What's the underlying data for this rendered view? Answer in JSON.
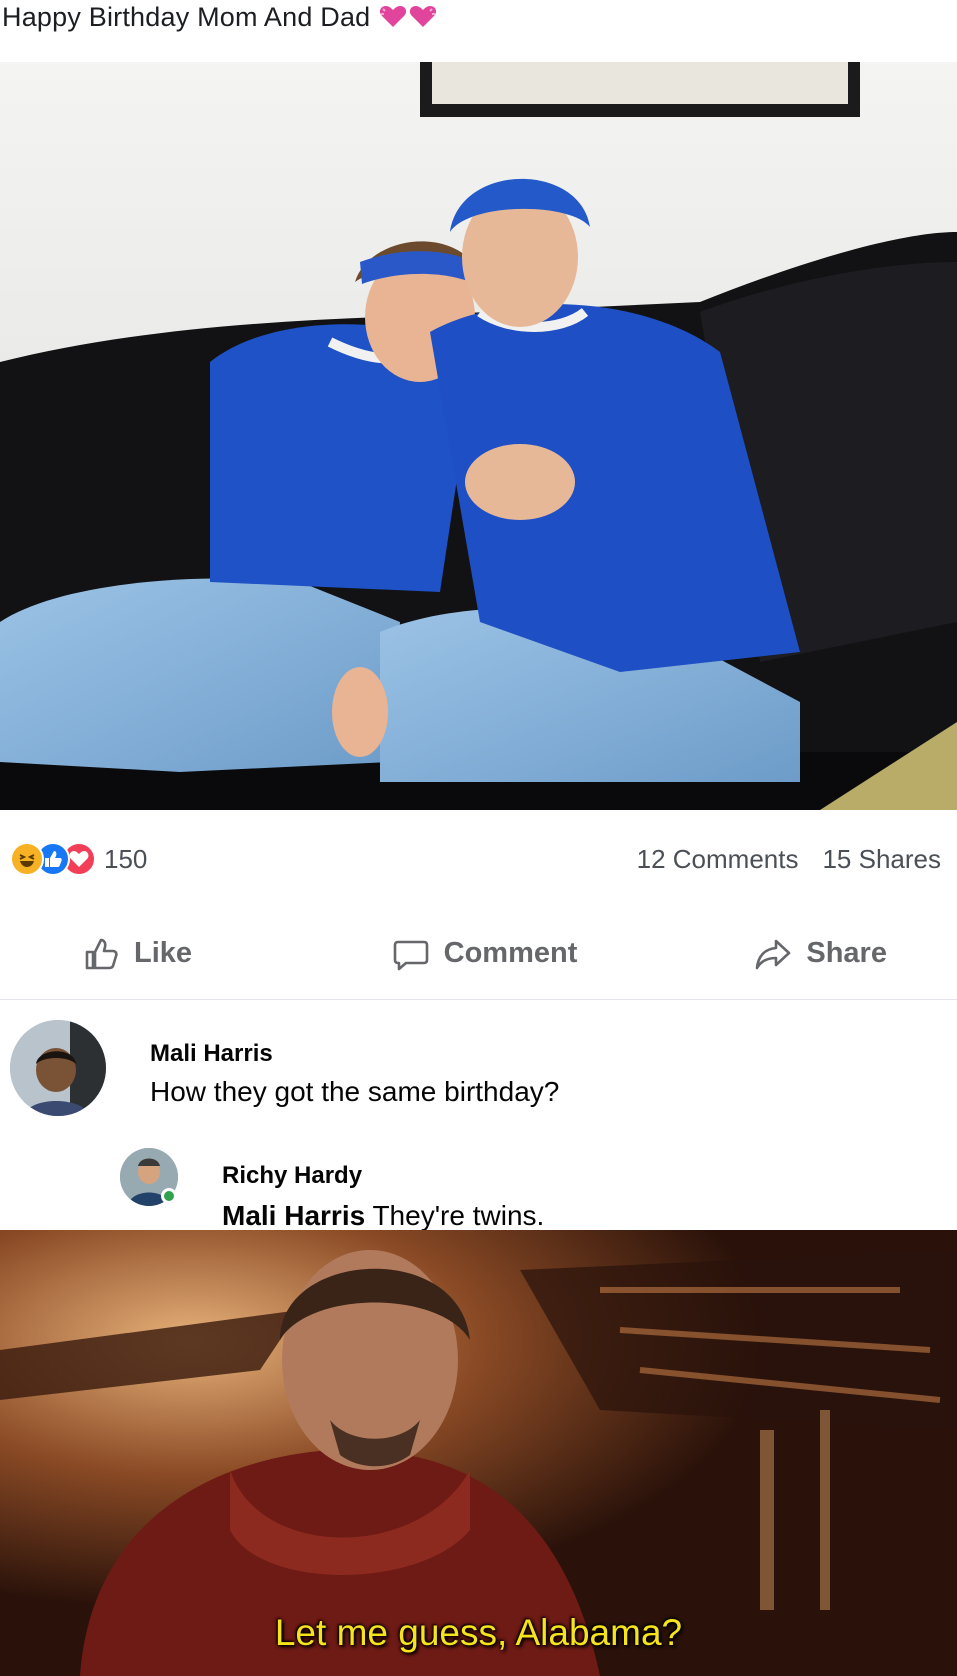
{
  "post": {
    "caption": "Happy Birthday Mom And Dad",
    "caption_emoji": "sparkling-heart-icon"
  },
  "stats": {
    "reaction_count": "150",
    "comments": "12 Comments",
    "shares": "15 Shares",
    "reactions": [
      "haha-icon",
      "like-icon",
      "love-icon"
    ]
  },
  "actions": {
    "like": "Like",
    "comment": "Comment",
    "share": "Share"
  },
  "comments": [
    {
      "author": "Mali Harris",
      "text": "How they got the same birthday?"
    },
    {
      "author": "Richy Hardy",
      "mention": "Mali Harris",
      "text": "They're twins."
    }
  ],
  "meme": {
    "subtitle": "Let me guess, Alabama?"
  },
  "colors": {
    "facebook_blue": "#1877f2",
    "love_red": "#f33e58",
    "haha_yellow": "#f7b125",
    "action_gray": "#65676b",
    "subtitle_yellow": "#f5e41b"
  }
}
